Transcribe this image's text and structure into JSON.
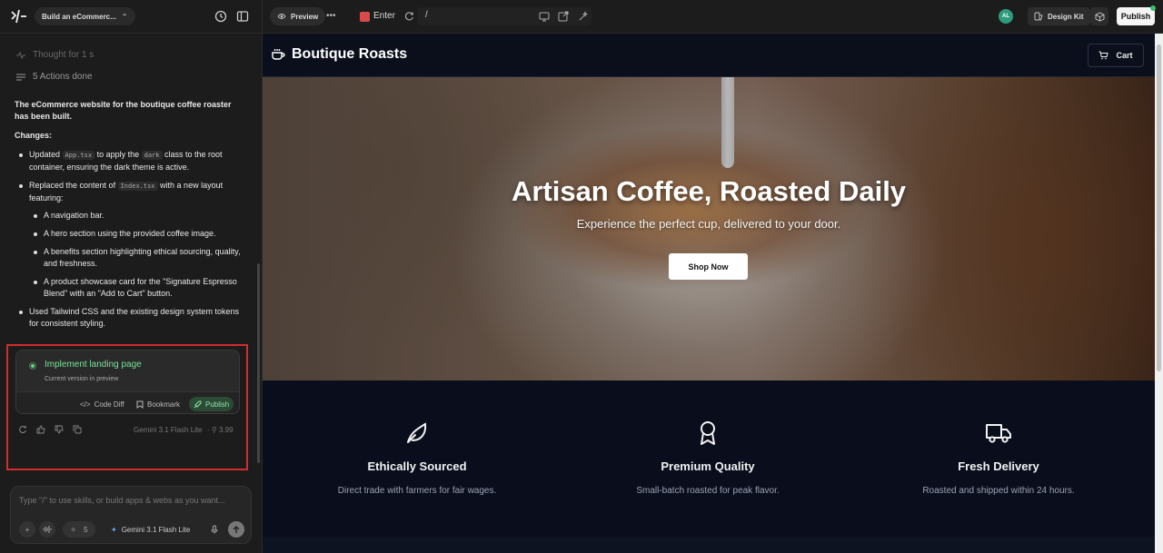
{
  "left_panel": {
    "project_name": "Build an eCommerc...",
    "thought": "Thought for 1 s",
    "actions_done": "5 Actions done",
    "message": {
      "intro": "The eCommerce website for the boutique coffee roaster has been built.",
      "changes_label": "Changes:",
      "item1_pre": "Updated",
      "item1_code1": "App.tsx",
      "item1_mid": "to apply the",
      "item1_code2": "dark",
      "item1_post": "class to the root container, ensuring the dark theme is active.",
      "item2_pre": "Replaced the content of",
      "item2_code": "Index.tsx",
      "item2_post": "with a new layout featuring:",
      "sub1": "A navigation bar.",
      "sub2": "A hero section using the provided coffee image.",
      "sub3": "A benefits section highlighting ethical sourcing, quality, and freshness.",
      "sub4": "A product showcase card for the \"Signature Espresso Blend\" with an \"Add to Cart\" button.",
      "item3": "Used Tailwind CSS and the existing design system tokens for consistent styling."
    },
    "version_card": {
      "title": "Implement landing page",
      "subtitle": "Current version in preview",
      "code_diff": "Code Diff",
      "bookmark": "Bookmark",
      "publish": "Publish"
    },
    "model": "Gemini 3.1 Flash Lite",
    "cost": "3.99",
    "input_placeholder": "Type \"/\" to use skills, or build apps & webs as you want...",
    "skills_count": "5",
    "model_selector": "Gemini 3.1 Flash Lite"
  },
  "topbar": {
    "preview_label": "Preview",
    "enter_label": "Enter",
    "path": "/",
    "avatar_initials": "AL",
    "design_kit": "Design Kit",
    "publish": "Publish"
  },
  "site": {
    "brand": "Boutique Roasts",
    "cart": "Cart",
    "hero_title": "Artisan Coffee, Roasted Daily",
    "hero_subtitle": "Experience the perfect cup, delivered to your door.",
    "shop_now": "Shop Now",
    "benefits": [
      {
        "icon": "leaf-icon",
        "title": "Ethically Sourced",
        "desc": "Direct trade with farmers for fair wages."
      },
      {
        "icon": "award-icon",
        "title": "Premium Quality",
        "desc": "Small-batch roasted for peak flavor."
      },
      {
        "icon": "truck-icon",
        "title": "Fresh Delivery",
        "desc": "Roasted and shipped within 24 hours."
      }
    ]
  },
  "colors": {
    "highlight_border": "#d42b2b",
    "accent_green": "#7ae29a",
    "site_bg": "#0b0f1c"
  }
}
